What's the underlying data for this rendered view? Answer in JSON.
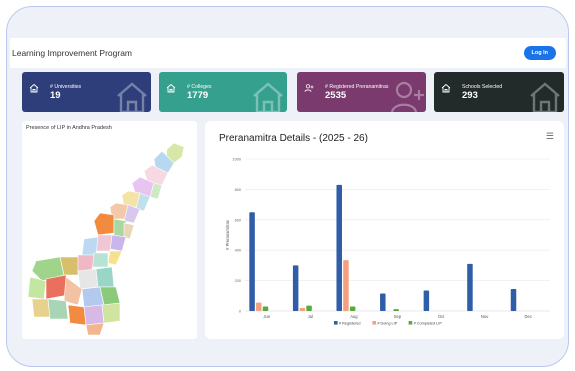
{
  "app": {
    "title": "Learning Improvement Program",
    "login_label": "Log In"
  },
  "cards": [
    {
      "label": "# Universities",
      "value": "19",
      "color": "#2d3e7a",
      "icon": "home-icon"
    },
    {
      "label": "# Colleges",
      "value": "1779",
      "color": "#36a08f",
      "icon": "home-icon"
    },
    {
      "label": "# Registered Preranamitras",
      "value": "2535",
      "color": "#7a3a6e",
      "icon": "user-add-icon"
    },
    {
      "label": "Schools Selected",
      "value": "293",
      "color": "#222a2a",
      "icon": "home-icon"
    }
  ],
  "map_panel": {
    "title": "Presence of LIP in Andhra Pradesh"
  },
  "chart_panel": {
    "title": "Preranamitra Details - (2025 - 26)"
  },
  "chart_data": {
    "type": "bar",
    "ylabel": "# Preranamitras",
    "ylim": [
      0,
      1000
    ],
    "yticks": [
      "0",
      "200",
      "400",
      "600",
      "800",
      "1000"
    ],
    "categories": [
      "Jun",
      "Jul",
      "Aug",
      "Sep",
      "Oct",
      "Nov",
      "Dec"
    ],
    "series": [
      {
        "name": "# Registered",
        "color": "#2f5da8",
        "values": [
          650,
          300,
          830,
          115,
          135,
          310,
          145
        ]
      },
      {
        "name": "# Doing LIP",
        "color": "#f4a07f",
        "values": [
          55,
          20,
          335,
          0,
          0,
          0,
          0
        ]
      },
      {
        "name": "# Completed LIP",
        "color": "#5aa83e",
        "values": [
          30,
          35,
          30,
          12,
          0,
          0,
          0
        ]
      }
    ],
    "legend": "bottom"
  }
}
